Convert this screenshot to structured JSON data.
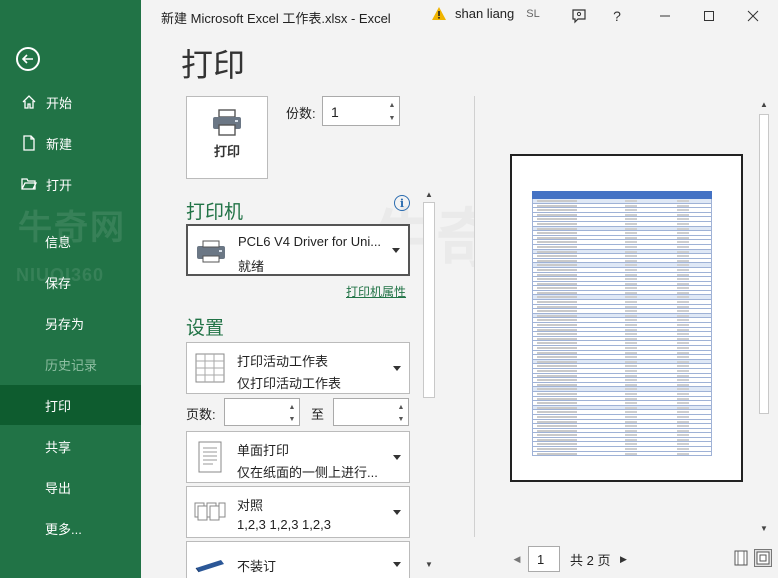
{
  "window": {
    "title": "新建 Microsoft Excel 工作表.xlsx  -  Excel",
    "user_name": "shan liang",
    "user_initials": "SL"
  },
  "sidebar": {
    "items": [
      {
        "label": "开始",
        "icon": "home-icon"
      },
      {
        "label": "新建",
        "icon": "new-document-icon"
      },
      {
        "label": "打开",
        "icon": "open-folder-icon"
      },
      {
        "label": "信息"
      },
      {
        "label": "保存"
      },
      {
        "label": "另存为"
      },
      {
        "label": "历史记录",
        "disabled": true
      },
      {
        "label": "打印",
        "active": true
      },
      {
        "label": "共享"
      },
      {
        "label": "导出"
      },
      {
        "label": "更多..."
      }
    ]
  },
  "main": {
    "title": "打印",
    "print_button_label": "打印",
    "copies_label": "份数:",
    "copies_value": "1",
    "printer_section_title": "打印机",
    "printer_name": "PCL6 V4 Driver for Uni...",
    "printer_status": "就绪",
    "printer_properties_link": "打印机属性",
    "settings_section_title": "设置",
    "settings": {
      "scope": {
        "primary": "打印活动工作表",
        "secondary": "仅打印活动工作表"
      },
      "pages_label": "页数:",
      "to_label": "至",
      "sides": {
        "primary": "单面打印",
        "secondary": "仅在纸面的一侧上进行..."
      },
      "collate": {
        "primary": "对照",
        "secondary": "1,2,3     1,2,3     1,2,3"
      },
      "binding": {
        "primary": "不装订"
      }
    }
  },
  "preview": {
    "current_page": "1",
    "total_pages": "共 2 页"
  },
  "colors": {
    "sidebar_bg": "#217346",
    "sidebar_active": "#0e5c2f",
    "accent": "#217346",
    "link": "#217346"
  }
}
